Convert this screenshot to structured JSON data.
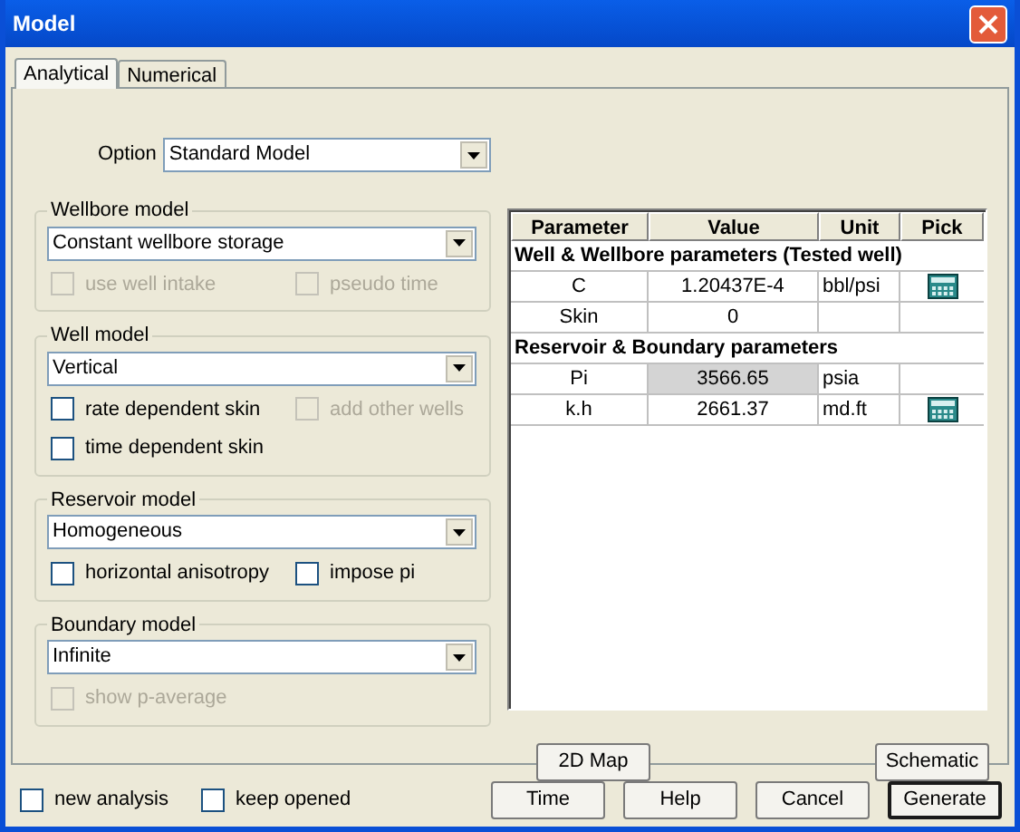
{
  "window": {
    "title": "Model"
  },
  "tabs": [
    {
      "label": "Analytical",
      "selected": true
    },
    {
      "label": "Numerical",
      "selected": false
    }
  ],
  "option": {
    "label": "Option",
    "value": "Standard Model"
  },
  "groups": [
    {
      "title": "Wellbore model",
      "value": "Constant wellbore storage",
      "checkboxes": [
        [
          {
            "label": "use well intake",
            "checked": false,
            "disabled": true
          },
          {
            "label": "pseudo time",
            "checked": false,
            "disabled": true
          }
        ]
      ]
    },
    {
      "title": "Well model",
      "value": "Vertical",
      "checkboxes": [
        [
          {
            "label": "rate dependent skin",
            "checked": false,
            "disabled": false
          },
          {
            "label": "add other wells",
            "checked": false,
            "disabled": true
          }
        ],
        [
          {
            "label": "time dependent skin",
            "checked": false,
            "disabled": false
          }
        ]
      ]
    },
    {
      "title": "Reservoir model",
      "value": "Homogeneous",
      "checkboxes": [
        [
          {
            "label": "horizontal anisotropy",
            "checked": false,
            "disabled": false
          },
          {
            "label": "impose pi",
            "checked": false,
            "disabled": false
          }
        ]
      ]
    },
    {
      "title": "Boundary model",
      "value": "Infinite",
      "checkboxes": [
        [
          {
            "label": "show p-average",
            "checked": false,
            "disabled": true
          }
        ]
      ]
    }
  ],
  "table": {
    "columns": [
      "Parameter",
      "Value",
      "Unit",
      "Pick"
    ],
    "rows": [
      {
        "kind": "section",
        "label": "Well & Wellbore parameters (Tested well)"
      },
      {
        "kind": "param",
        "parameter": "C",
        "value": "1.20437E-4",
        "unit": "bbl/psi",
        "pick": true,
        "fixed": false
      },
      {
        "kind": "param",
        "parameter": "Skin",
        "value": "0",
        "pick": false,
        "fixed": false
      },
      {
        "kind": "section",
        "label": "Reservoir & Boundary parameters"
      },
      {
        "kind": "param",
        "parameter": "Pi",
        "value": "3566.65",
        "unit": "psia",
        "pick": false,
        "fixed": true
      },
      {
        "kind": "param",
        "parameter": "k.h",
        "value": "2661.37",
        "unit": "md.ft",
        "pick": true,
        "fixed": false
      }
    ]
  },
  "panel_buttons": [
    "2D Map",
    "Schematic"
  ],
  "footer_checkboxes": [
    {
      "label": "new analysis",
      "checked": false
    },
    {
      "label": "keep opened",
      "checked": false
    }
  ],
  "footer_buttons": [
    {
      "label": "Time",
      "default": false
    },
    {
      "label": "Help",
      "default": false
    },
    {
      "label": "Cancel",
      "default": false
    },
    {
      "label": "Generate",
      "default": true
    }
  ]
}
